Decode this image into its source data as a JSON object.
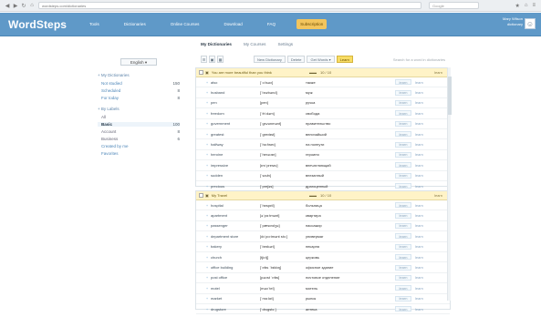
{
  "browser": {
    "url": "wordsteps.com/dictionaries",
    "search": "Google",
    "nav_back": "◀",
    "nav_forward": "▶",
    "nav_reload": "↻",
    "nav_home": "⌂",
    "tool_icons": [
      "★",
      "⌂",
      "≡"
    ]
  },
  "app": {
    "logo": "WordSteps",
    "nav": [
      "Tools",
      "Dictionaries",
      "Online Courses",
      "Download",
      "FAQ",
      "Subscription"
    ],
    "active_nav": "Subscription",
    "user_line1": "Mary Wilson",
    "user_line2": "dictionary",
    "avatar_icon": "user-avatar"
  },
  "tabs": [
    "My Dictionaries",
    "My Courses",
    "Settings"
  ],
  "toolbar": {
    "buttons": [
      "New Dictionary",
      "Delete",
      "Get Words ▾"
    ],
    "action": "Learn",
    "hint": "Search for a word in dictionaries"
  },
  "sidebar": {
    "language": "English ▾",
    "sections": [
      {
        "title": "+ My Dictionaries",
        "rows": [
          {
            "label": "Not studied",
            "count": "150"
          },
          {
            "label": "Scheduled",
            "count": "8"
          },
          {
            "label": "For today",
            "count": "8"
          }
        ]
      },
      {
        "title": "+ By Labels",
        "rows": [
          {
            "label": "All",
            "count": ""
          },
          {
            "label": "Basic",
            "count": "100"
          },
          {
            "label": "Account",
            "count": "8"
          },
          {
            "label": "Business",
            "count": "6"
          },
          {
            "label": "Created by me",
            "count": ""
          },
          {
            "label": "Favorites",
            "count": ""
          }
        ]
      }
    ]
  },
  "panels": [
    {
      "title": "You are more beautiful than you think",
      "mid": "10 / 10",
      "right": "learn",
      "rows": [
        [
          "also",
          "[ˈɔːlsəʊ]",
          "также"
        ],
        [
          "husband",
          "[ˈhʌzbənd]",
          "муж"
        ],
        [
          "pen",
          "[pen]",
          "ручка"
        ],
        [
          "freedom",
          "[ˈfriːdəm]",
          "свобода"
        ],
        [
          "government",
          "[ˈɡʌvənmənt]",
          "правительство"
        ],
        [
          "greatest",
          "[ˈɡreɪtɪst]",
          "величайший"
        ],
        [
          "halfway",
          "[ˈhɑːfweɪ]",
          "на полпути"
        ],
        [
          "heroine",
          "[ˈherəʊɪn]",
          "героиня"
        ],
        [
          "impressive",
          "[ɪmˈpresɪv]",
          "впечатляющий"
        ],
        [
          "sudden",
          "[ˈsʌdn]",
          "внезапный"
        ],
        [
          "precious",
          "[ˈpreʃəs]",
          "драгоценный"
        ]
      ]
    },
    {
      "title": "My Travel",
      "mid": "10 / 10",
      "right": "learn",
      "rows": [
        [
          "hospital",
          "[ˈhɒspɪtl]",
          "больница"
        ],
        [
          "apartment",
          "[əˈpɑːtmənt]",
          "квартира"
        ],
        [
          "passenger",
          "[ˈpæsɪndʒə]",
          "пассажир"
        ],
        [
          "department store",
          "[dɪˈpɑːtmənt stɔː]",
          "универмаг"
        ],
        [
          "bakery",
          "[ˈbeɪkəri]",
          "пекарня"
        ],
        [
          "church",
          "[tʃɜːtʃ]",
          "церковь"
        ],
        [
          "office building",
          "[ˈɒfɪs ˈbɪldɪŋ]",
          "офисное здание"
        ],
        [
          "post office",
          "[pəʊst ˈɒfɪs]",
          "почтовое отделение"
        ],
        [
          "motel",
          "[məʊˈtel]",
          "мотель"
        ],
        [
          "market",
          "[ˈmɑːkɪt]",
          "рынок"
        ],
        [
          "drugstore",
          "[ˈdrʌɡstɔː]",
          "аптека"
        ]
      ]
    }
  ]
}
